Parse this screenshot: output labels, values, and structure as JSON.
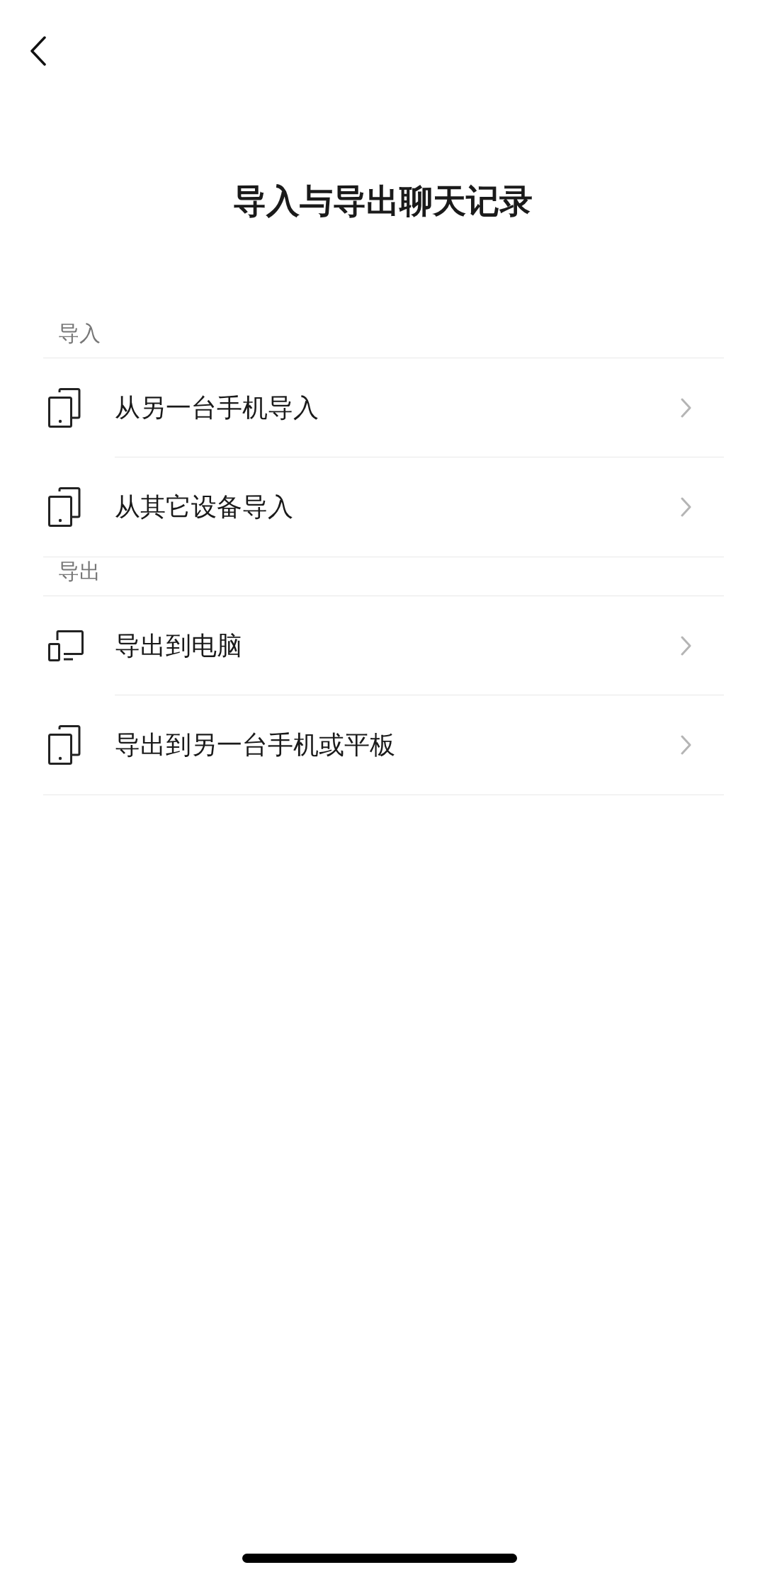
{
  "title": "导入与导出聊天记录",
  "sections": [
    {
      "label": "导入",
      "items": [
        {
          "kind": "phones",
          "label": "从另一台手机导入"
        },
        {
          "kind": "phones",
          "label": "从其它设备导入"
        }
      ]
    },
    {
      "label": "导出",
      "items": [
        {
          "kind": "computer",
          "label": "导出到电脑"
        },
        {
          "kind": "phones",
          "label": "导出到另一台手机或平板"
        }
      ]
    }
  ]
}
